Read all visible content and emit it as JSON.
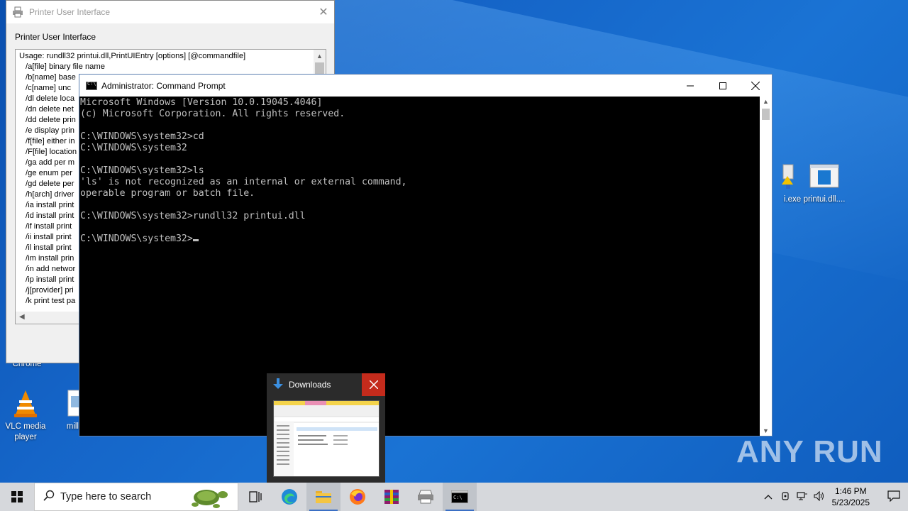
{
  "printer_ui": {
    "title": "Printer User Interface",
    "label": "Printer User Interface",
    "lines": [
      "Usage: rundll32 printui.dll,PrintUIEntry [options] [@commandfile]",
      "/a[file] binary file name",
      "/b[name] base",
      "/c[name] unc",
      "/dl delete loca",
      "/dn delete net",
      "/dd delete prin",
      "/e display prin",
      "/f[file] either in",
      "/F[file] location",
      "/ga add per m",
      "/ge enum per",
      "/gd delete per",
      "/h[arch] driver",
      "/ia install print",
      "/id install print",
      "/if install print",
      "/ii install print",
      "/il install print",
      "/im install prin",
      "/in add networ",
      "/ip install print",
      "/j[provider] pri",
      "/k print test pa"
    ]
  },
  "cmd": {
    "title": "Administrator: Command Prompt",
    "lines": [
      "Microsoft Windows [Version 10.0.19045.4046]",
      "(c) Microsoft Corporation. All rights reserved.",
      "",
      "C:\\WINDOWS\\system32>cd",
      "C:\\WINDOWS\\system32",
      "",
      "C:\\WINDOWS\\system32>ls",
      "'ls' is not recognized as an internal or external command,",
      "operable program or batch file.",
      "",
      "C:\\WINDOWS\\system32>rundll32 printui.dll",
      ""
    ],
    "prompt": "C:\\WINDOWS\\system32>"
  },
  "desktop_icons": [
    {
      "label": "Chrome",
      "icon": "chrome-icon"
    },
    {
      "label": "VLC media player",
      "icon": "vlc-icon"
    },
    {
      "label": "million",
      "icon": "image-file-icon"
    },
    {
      "label": "i.exe",
      "icon": "installer-icon"
    },
    {
      "label": "printui.dll....",
      "icon": "dll-file-icon"
    }
  ],
  "preview": {
    "title": "Downloads"
  },
  "watermark": "ANY RUN",
  "taskbar": {
    "search_placeholder": "Type here to search",
    "time": "1:46 PM",
    "date": "5/23/2025"
  },
  "colors": {
    "accent": "#0078d7",
    "close": "#c42b1c",
    "cmd_text": "#c0c0c0"
  }
}
